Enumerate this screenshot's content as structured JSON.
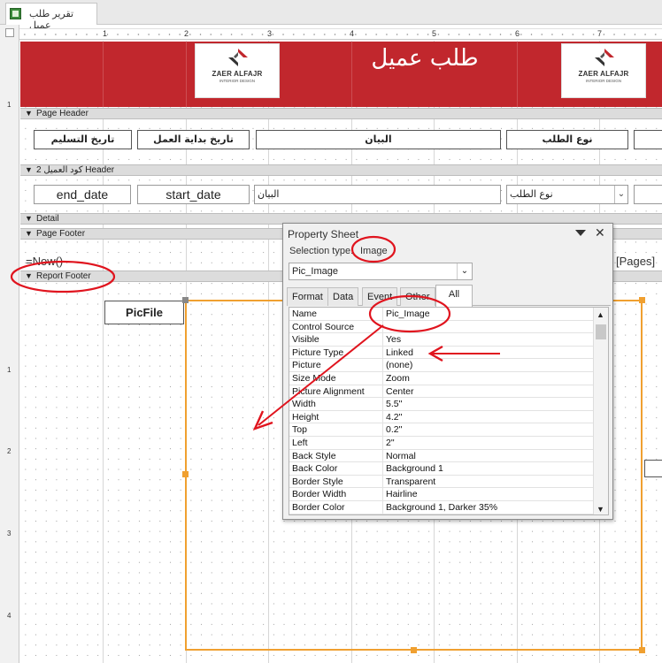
{
  "tab": {
    "title": "تقرير طلب عميل",
    "icon": "report-icon"
  },
  "ruler": {
    "numbers": [
      "1",
      "2",
      "3",
      "4",
      "5",
      "6",
      "7"
    ],
    "vnumbers": [
      "1",
      "1",
      "2",
      "3",
      "4"
    ]
  },
  "report_header": {
    "title": "طلب عميل",
    "logo_name": "ZAER ALFAJR",
    "logo_sub": "INTERIOR DESIGN"
  },
  "bands": {
    "page_header": "Page Header",
    "group_header": "كود العميل 2 Header",
    "detail": "Detail",
    "page_footer": "Page Footer",
    "report_footer": "Report Footer"
  },
  "page_header_labels": {
    "delivery_date": "تاريخ التسليم",
    "start_date": "تاريخ بداية العمل",
    "statement": "البيان",
    "request_type": "نوع الطلب"
  },
  "group_fields": {
    "end_date": "end_date",
    "start_date": "start_date",
    "statement": "البيان",
    "request_type": "نوع الطلب"
  },
  "page_footer": {
    "now_expr": "=Now()",
    "pages_expr": "[Pages]"
  },
  "report_footer": {
    "picfile_label": "PicFile"
  },
  "property_sheet": {
    "title": "Property Sheet",
    "selection_label": "Selection type:",
    "selection_value": "Image",
    "object": "Pic_Image",
    "tabs": [
      "Format",
      "Data",
      "Event",
      "Other",
      "All"
    ],
    "active_tab": "All",
    "rows": [
      {
        "name": "Name",
        "value": "Pic_Image"
      },
      {
        "name": "Control Source",
        "value": ""
      },
      {
        "name": "Visible",
        "value": "Yes"
      },
      {
        "name": "Picture Type",
        "value": "Linked"
      },
      {
        "name": "Picture",
        "value": "(none)"
      },
      {
        "name": "Size Mode",
        "value": "Zoom"
      },
      {
        "name": "Picture Alignment",
        "value": "Center"
      },
      {
        "name": "Width",
        "value": "5.5\""
      },
      {
        "name": "Height",
        "value": "4.2\""
      },
      {
        "name": "Top",
        "value": "0.2\""
      },
      {
        "name": "Left",
        "value": "2\""
      },
      {
        "name": "Back Style",
        "value": "Normal"
      },
      {
        "name": "Back Color",
        "value": "Background 1"
      },
      {
        "name": "Border Style",
        "value": "Transparent"
      },
      {
        "name": "Border Width",
        "value": "Hairline"
      },
      {
        "name": "Border Color",
        "value": "Background 1, Darker 35%"
      }
    ]
  },
  "colors": {
    "header_red": "#c1272d",
    "annotation_red": "#e0141e",
    "selection_orange": "#f0a030"
  }
}
